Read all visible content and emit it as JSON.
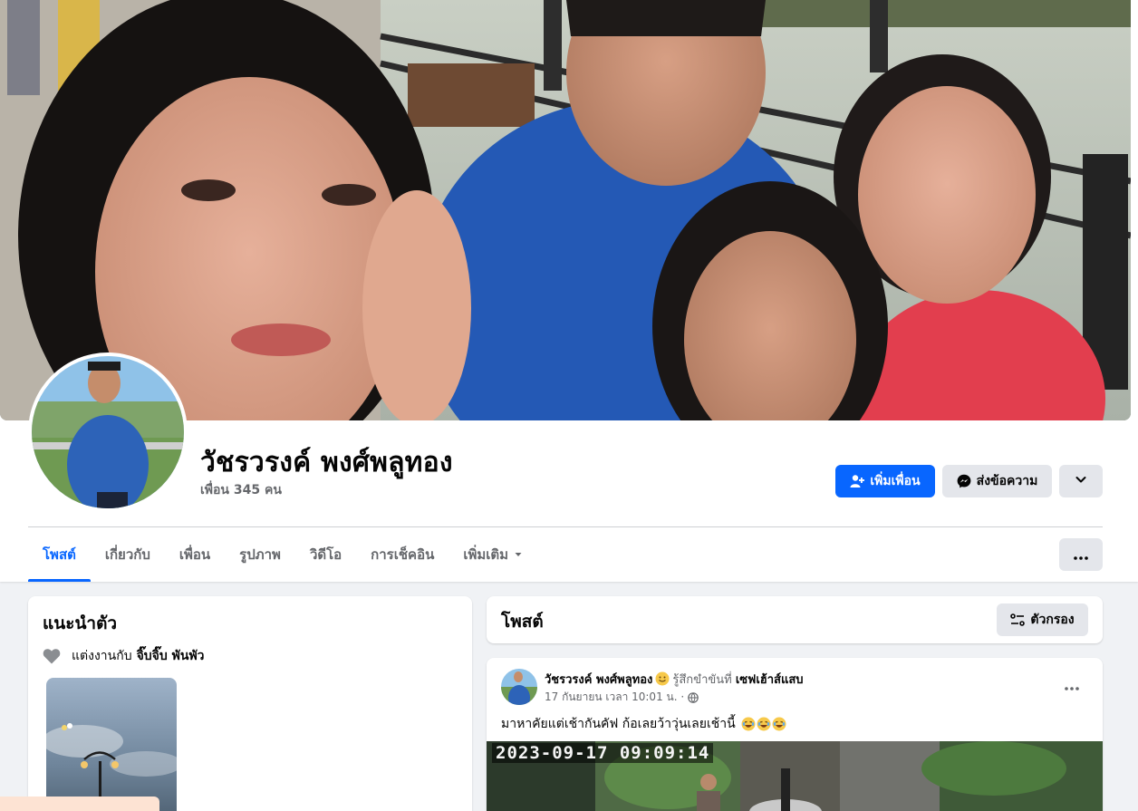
{
  "profile": {
    "name": "วัชรวรงค์ พงศ์พลูทอง",
    "friends_count_text": "เพื่อน 345 คน"
  },
  "actions": {
    "add_friend_label": "เพิ่มเพื่อน",
    "message_label": "ส่งข้อความ"
  },
  "tabs": [
    {
      "label": "โพสต์",
      "active": true
    },
    {
      "label": "เกี่ยวกับ"
    },
    {
      "label": "เพื่อน"
    },
    {
      "label": "รูปภาพ"
    },
    {
      "label": "วิดีโอ"
    },
    {
      "label": "การเช็คอิน"
    },
    {
      "label": "เพิ่มเติม"
    }
  ],
  "intro": {
    "title": "แนะนำตัว",
    "relationship_prefix": "แต่งงานกับ",
    "partner_name": "จิ๊บจิ๊บ พันพัว"
  },
  "posts_section": {
    "title": "โพสต์",
    "filter_label": "ตัวกรอง"
  },
  "post": {
    "author": "วัชรวรงค์ พงศ์พลูทอง",
    "feeling": "รู้สึกขำขันที่",
    "place": "เซฟเฮ้าส์แสบ",
    "time": "17 กันยายน เวลา 10:01 น. ·",
    "text": "มาหาคัยแต่เช้ากันคัฟ ก้อเลยว้าวุ่นเลยเช้านี้",
    "image_timestamp": "2023-09-17  09:09:14"
  },
  "colors": {
    "primary": "#0866ff",
    "button_gray": "#e4e6eb",
    "muted_text": "#65676b",
    "page_bg": "#f0f2f5"
  }
}
